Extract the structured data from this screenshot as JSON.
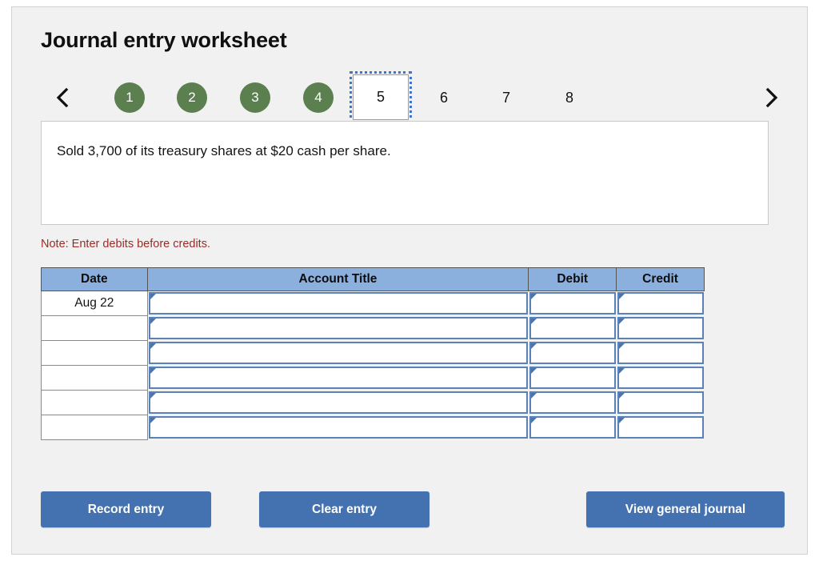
{
  "header": {
    "title": "Journal entry worksheet"
  },
  "pager": {
    "prev_icon": "chevron-left-icon",
    "next_icon": "chevron-right-icon",
    "steps": [
      {
        "label": "1",
        "state": "done"
      },
      {
        "label": "2",
        "state": "done"
      },
      {
        "label": "3",
        "state": "done"
      },
      {
        "label": "4",
        "state": "done"
      },
      {
        "label": "5",
        "state": "active"
      },
      {
        "label": "6",
        "state": "plain"
      },
      {
        "label": "7",
        "state": "plain"
      },
      {
        "label": "8",
        "state": "plain"
      }
    ],
    "active_step": "5",
    "done_color": "#5b7f4f",
    "focus_color": "#4573c4"
  },
  "transaction": {
    "description": "Sold 3,700 of its treasury shares at $20 cash per share."
  },
  "note": {
    "text": "Note: Enter debits before credits.",
    "color": "#9e2a26"
  },
  "table": {
    "headers": [
      "Date",
      "Account Title",
      "Debit",
      "Credit"
    ],
    "header_bg": "#8cb0dd",
    "field_border": "#5b82b8",
    "rows": [
      {
        "date": "Aug 22",
        "account": "",
        "debit": "",
        "credit": ""
      },
      {
        "date": "",
        "account": "",
        "debit": "",
        "credit": ""
      },
      {
        "date": "",
        "account": "",
        "debit": "",
        "credit": ""
      },
      {
        "date": "",
        "account": "",
        "debit": "",
        "credit": ""
      },
      {
        "date": "",
        "account": "",
        "debit": "",
        "credit": ""
      },
      {
        "date": "",
        "account": "",
        "debit": "",
        "credit": ""
      }
    ]
  },
  "buttons": {
    "record": "Record entry",
    "clear": "Clear entry",
    "view": "View general journal",
    "color": "#4472b0"
  }
}
